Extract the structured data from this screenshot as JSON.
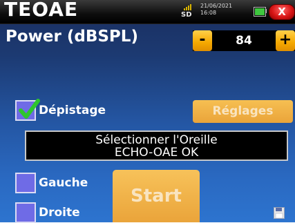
{
  "titlebar": {
    "title": "TEOAE",
    "sd_label": "SD",
    "date": "21/06/2021",
    "time": "16:08",
    "battery_level": 1.0,
    "close_label": "X"
  },
  "power": {
    "label": "Power (dBSPL)",
    "minus_label": "-",
    "value": "84",
    "plus_label": "+"
  },
  "screening": {
    "label": "Dépistage",
    "checked": true
  },
  "settings_button": "Réglages",
  "status": {
    "line1": "Sélectionner l'Oreille",
    "line2": "ECHO-OAE OK"
  },
  "ears": {
    "left_label": "Gauche",
    "right_label": "Droite"
  },
  "start_button": "Start",
  "icons": {
    "close": "close-icon",
    "sd": "sd-card-icon",
    "battery": "battery-icon",
    "check": "check-icon",
    "save": "save-icon"
  },
  "colors": {
    "accent": "#f5a800",
    "checkbox": "#6f6be6",
    "check": "#2ec52e",
    "close": "#d91616"
  }
}
